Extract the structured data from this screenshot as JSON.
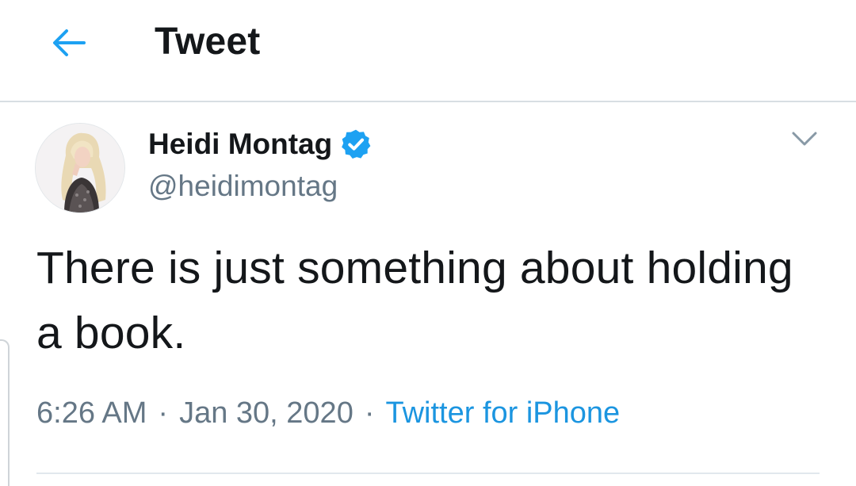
{
  "header": {
    "title": "Tweet",
    "back_icon": "arrow-left-icon",
    "accent_color": "#1da1f2"
  },
  "tweet": {
    "author": {
      "display_name": "Heidi Montag",
      "handle": "@heidimontag",
      "verified": true,
      "verified_icon": "verified-badge-icon",
      "avatar": "profile-avatar"
    },
    "menu_icon": "chevron-down-icon",
    "text": "There is just something about holding a book.",
    "time": "6:26 AM",
    "separator": "·",
    "date": "Jan 30, 2020",
    "source": "Twitter for iPhone"
  },
  "colors": {
    "text_primary": "#14171a",
    "text_secondary": "#657786",
    "link": "#1b95e0",
    "divider": "#e1e8ed"
  }
}
